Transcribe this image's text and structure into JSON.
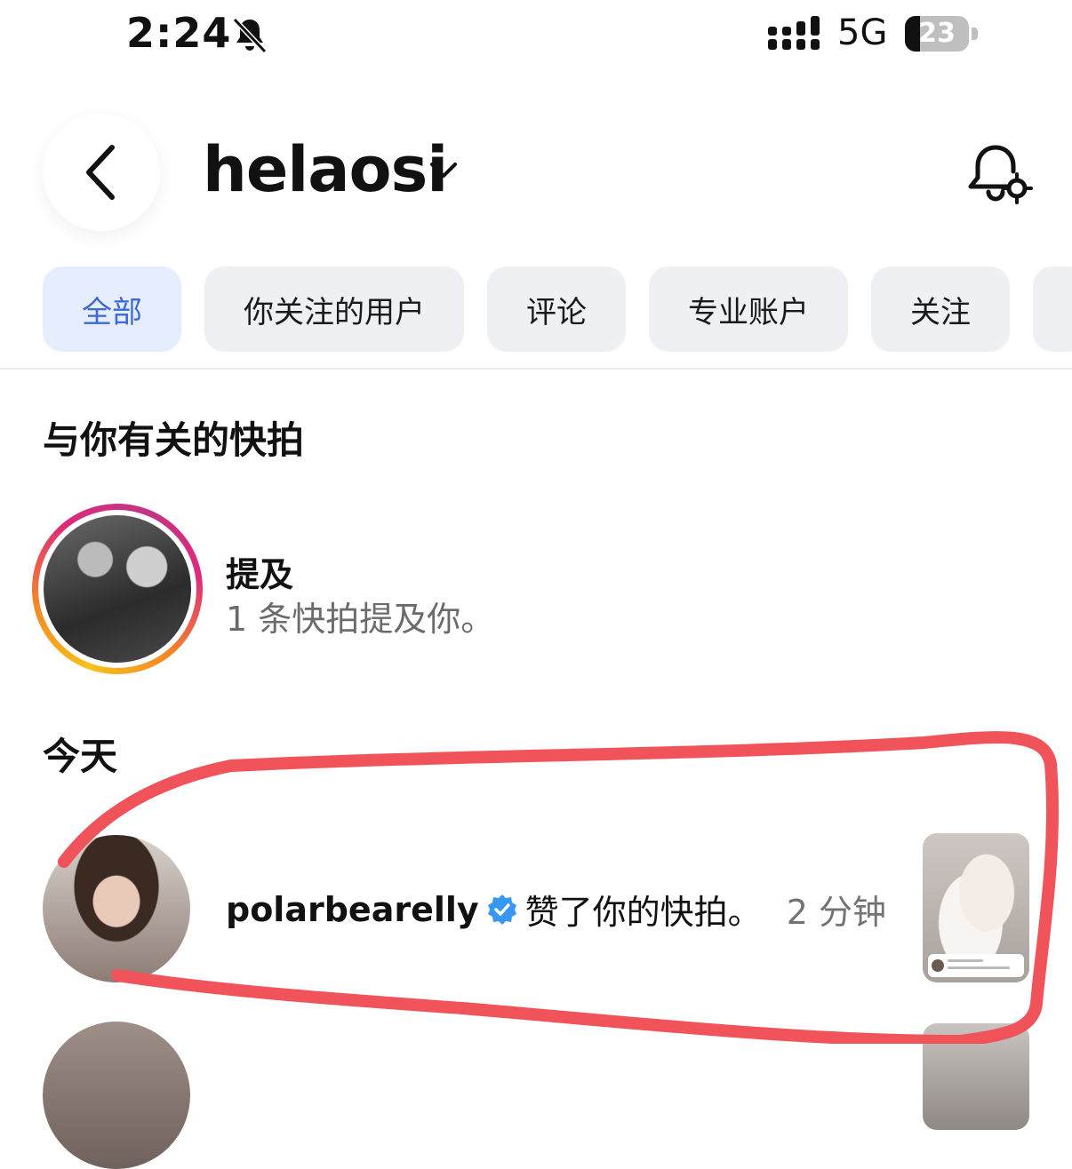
{
  "status_bar": {
    "time": "2:24",
    "network": "5G",
    "battery": "23",
    "battery_level_percent": 23,
    "icons": [
      "bell-off-icon",
      "signal-icon",
      "battery-icon"
    ]
  },
  "header": {
    "username": "helaosi",
    "icons": [
      "back-icon",
      "chevron-down-icon",
      "bell-settings-icon"
    ]
  },
  "tabs": [
    {
      "label": "全部",
      "active": true
    },
    {
      "label": "你关注的用户",
      "active": false
    },
    {
      "label": "评论",
      "active": false
    },
    {
      "label": "专业账户",
      "active": false
    },
    {
      "label": "关注",
      "active": false
    }
  ],
  "snapshots_section": {
    "title": "与你有关的快拍",
    "mention": {
      "title": "提及",
      "subtitle": "1 条快拍提及你。"
    }
  },
  "today_section": {
    "title": "今天",
    "notification": {
      "username": "polarbearelly",
      "action": "赞了你的快拍。",
      "time": "2 分钟"
    }
  },
  "colors": {
    "active_tab_bg": "#e6edfc",
    "active_tab_text": "#3c68d8",
    "verified_blue": "#3897f0",
    "annotation_red": "#f0545a"
  }
}
